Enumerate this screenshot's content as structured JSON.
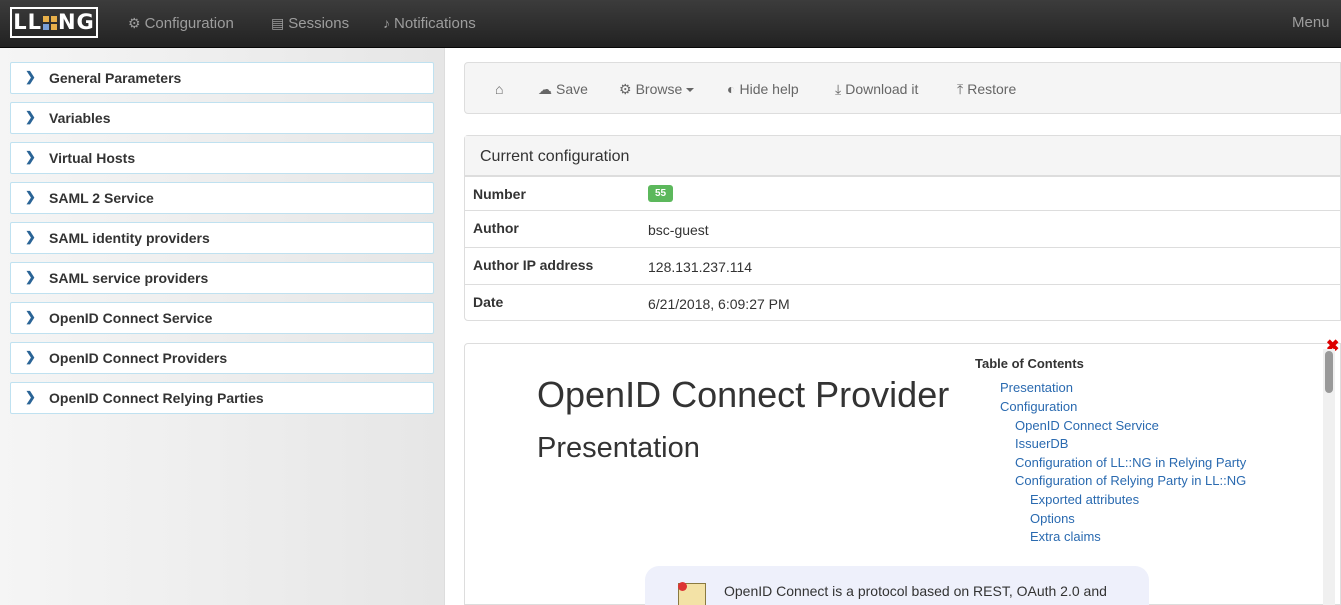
{
  "app": {
    "logo_text_left": "LL",
    "logo_text_right": "NG"
  },
  "navbar": {
    "configuration": "Configuration",
    "sessions": "Sessions",
    "notifications": "Notifications",
    "menu": "Menu",
    "configuration_icon": "gear-icon",
    "sessions_icon": "file-icon",
    "notifications_icon": "bell-icon"
  },
  "tree": {
    "items": [
      {
        "label": "General Parameters"
      },
      {
        "label": "Variables"
      },
      {
        "label": "Virtual Hosts"
      },
      {
        "label": "SAML 2 Service"
      },
      {
        "label": "SAML identity providers"
      },
      {
        "label": "SAML service providers"
      },
      {
        "label": "OpenID Connect Service"
      },
      {
        "label": "OpenID Connect Providers"
      },
      {
        "label": "OpenID Connect Relying Parties"
      }
    ]
  },
  "toolbar": {
    "save": "Save",
    "browse": "Browse",
    "hide_help": "Hide help",
    "download": "Download it",
    "restore": "Restore"
  },
  "current_config": {
    "title": "Current configuration",
    "rows": [
      {
        "key": "Number",
        "value": "55"
      },
      {
        "key": "Author",
        "value": "bsc-guest"
      },
      {
        "key": "Author IP address",
        "value": "128.131.237.114"
      },
      {
        "key": "Date",
        "value": "6/21/2018, 6:09:27 PM"
      }
    ]
  },
  "help": {
    "title": "OpenID Connect Provider",
    "subtitle": "Presentation",
    "toc_title": "Table of Contents",
    "toc": [
      "Presentation",
      "Configuration",
      "OpenID Connect Service",
      "IssuerDB",
      "Configuration of LL::NG in Relying Party",
      "Configuration of Relying Party in LL::NG",
      "Exported attributes",
      "Options",
      "Extra claims"
    ],
    "note": "OpenID Connect is a protocol based on REST, OAuth 2.0 and"
  },
  "colors": {
    "navbar": "#222222",
    "accent": "#2a6496",
    "badge": "#5cb85c",
    "link": "#2a6ab0"
  }
}
